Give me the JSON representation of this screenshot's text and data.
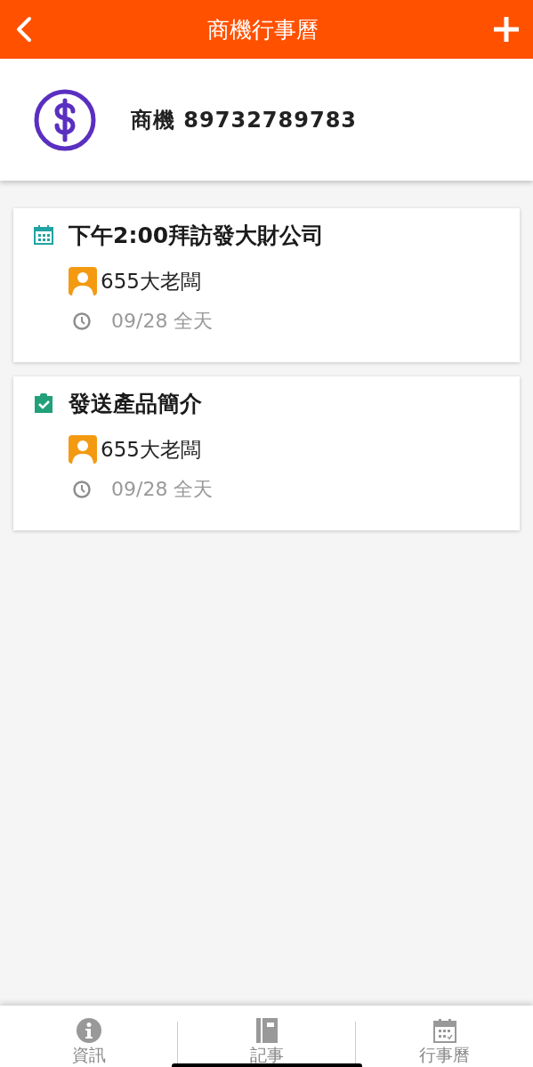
{
  "header": {
    "title": "商機行事曆"
  },
  "opportunity": {
    "label": "商機 89732789783"
  },
  "entries": [
    {
      "kind": "event",
      "title": "下午2:00拜訪發大財公司",
      "contact": "655大老闆",
      "time": "09/28 全天"
    },
    {
      "kind": "task",
      "title": "發送產品簡介",
      "contact": "655大老闆",
      "time": "09/28 全天"
    }
  ],
  "tabs": [
    {
      "kind": "info",
      "label": "資訊"
    },
    {
      "kind": "notes",
      "label": "記事"
    },
    {
      "kind": "calendar",
      "label": "行事曆"
    }
  ]
}
